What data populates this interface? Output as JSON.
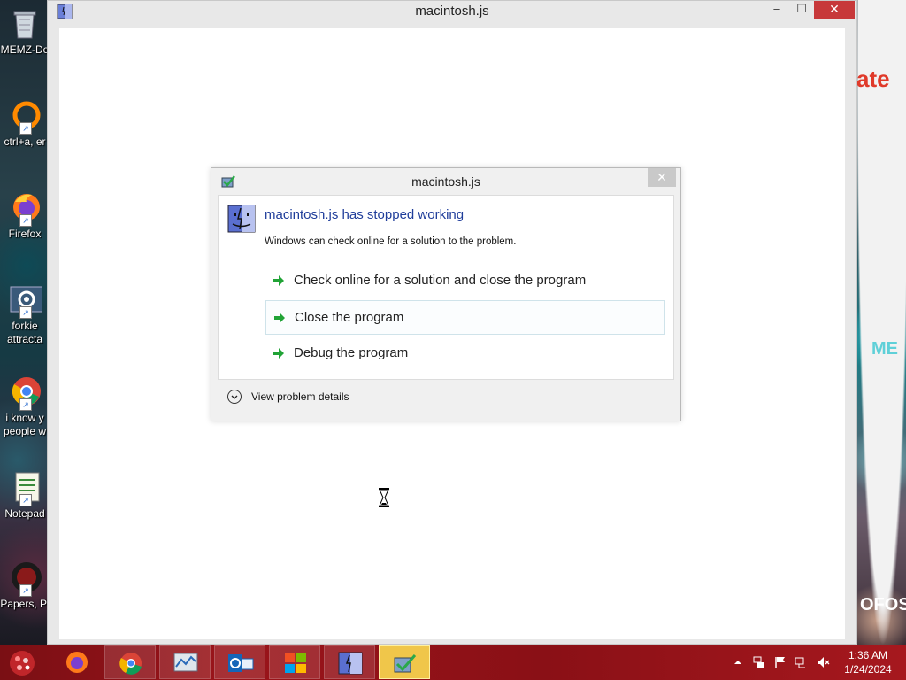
{
  "desktop": {
    "icons": [
      {
        "label": "MEMZ-De",
        "icon": "recycle-bin-icon"
      },
      {
        "label": "ctrl+a, er",
        "icon": "shortcut-ring-icon"
      },
      {
        "label": "Firefox",
        "icon": "firefox-icon"
      },
      {
        "label": "forkie attracta",
        "icon": "settings-app-icon"
      },
      {
        "label": "i know y people w",
        "icon": "chrome-icon"
      },
      {
        "label": "Notepad",
        "icon": "notepad-icon"
      },
      {
        "label": "Papers, Pl",
        "icon": "papers-please-icon"
      }
    ],
    "wallpaper_texts": {
      "top": "ate",
      "middle": "ME",
      "bottom": "OFOS"
    }
  },
  "main_window": {
    "title": "macintosh.js",
    "controls": {
      "minimize": "–",
      "maximize": "☐",
      "close": "✕"
    }
  },
  "dialog": {
    "title": "macintosh.js",
    "close": "✕",
    "heading": "macintosh.js has stopped working",
    "subtext": "Windows can check online for a solution to the problem.",
    "options": [
      "Check online for a solution and close the program",
      "Close the program",
      "Debug the program"
    ],
    "details_label": "View problem details"
  },
  "taskbar": {
    "apps": [
      "firefox-icon",
      "chrome-icon",
      "resource-monitor-icon",
      "outlook-icon",
      "windows-logo-icon",
      "finder-icon",
      "error-report-icon"
    ],
    "clock": {
      "time": "1:36 AM",
      "date": "1/24/2024"
    },
    "tray": [
      "show-hidden-icons",
      "network-icon",
      "action-center-flag-icon",
      "network-wired-icon",
      "volume-muted-icon"
    ]
  },
  "colors": {
    "accent": "#1f3d9a",
    "taskbar": "#9a141a",
    "close_red": "#c7383a"
  }
}
